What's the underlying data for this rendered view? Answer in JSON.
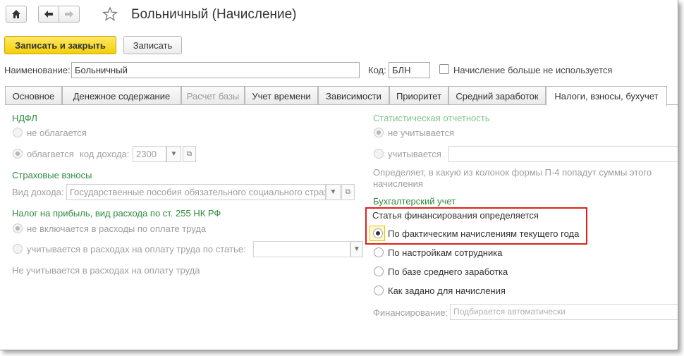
{
  "title": "Больничный (Начисление)",
  "toolbar": {
    "save_close": "Записать и закрыть",
    "save": "Записать"
  },
  "form": {
    "name_label": "Наименование:",
    "name_value": "Больничный",
    "code_label": "Код:",
    "code_value": "БЛН",
    "unused_label": "Начисление больше не используется"
  },
  "tabs": [
    "Основное",
    "Денежное содержание",
    "Расчет базы",
    "Учет времени",
    "Зависимости",
    "Приоритет",
    "Средний заработок",
    "Налоги, взносы, бухучет"
  ],
  "left": {
    "ndfl_title": "НДФЛ",
    "ndfl_opt1": "не облагается",
    "ndfl_opt2": "облагается",
    "income_code_label": "код дохода:",
    "income_code_value": "2300",
    "insurance_title": "Страховые взносы",
    "income_type_label": "Вид дохода:",
    "income_type_value": "Государственные пособия обязательного социального страх",
    "profit_tax_title": "Налог на прибыль, вид расхода по ст. 255 НК РФ",
    "profit_opt1": "не включается в расходы по оплате труда",
    "profit_opt2": "учитывается в расходах на оплату труда по статье:",
    "profit_note": "Не учитывается в расходах на оплату труда"
  },
  "right": {
    "stat_title": "Статистическая отчетность",
    "stat_opt1": "не учитывается",
    "stat_opt2": "учитывается",
    "stat_note": "Определяет, в какую из колонок формы П-4 попадут суммы этого начисления",
    "acct_title": "Бухгалтерский учет",
    "funding_heading": "Статья финансирования определяется",
    "fund_opt1": "По фактическим начислениям текущего года",
    "fund_opt2": "По настройкам сотрудника",
    "fund_opt3": "По базе среднего заработка",
    "fund_opt4": "Как задано для начисления",
    "financing_label": "Финансирование:",
    "financing_placeholder": "Подбирается автоматически"
  }
}
